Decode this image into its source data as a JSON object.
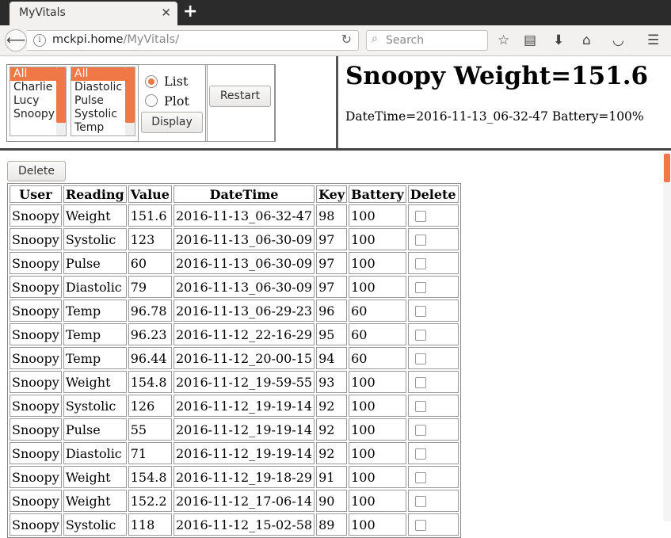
{
  "browser": {
    "tab_title": "MyVitals",
    "url_host": "mckpi.home",
    "url_path": "/MyVitals/",
    "search_placeholder": "Search"
  },
  "controls": {
    "users": [
      {
        "label": "All",
        "selected": true
      },
      {
        "label": "Charlie",
        "selected": false
      },
      {
        "label": "Lucy",
        "selected": false
      },
      {
        "label": "Snoopy",
        "selected": false
      }
    ],
    "readings": [
      {
        "label": "All",
        "selected": true
      },
      {
        "label": "Diastolic",
        "selected": false
      },
      {
        "label": "Pulse",
        "selected": false
      },
      {
        "label": "Systolic",
        "selected": false
      },
      {
        "label": "Temp",
        "selected": false
      }
    ],
    "mode_list_label": "List",
    "mode_plot_label": "Plot",
    "mode_selected": "List",
    "display_label": "Display",
    "restart_label": "Restart"
  },
  "summary": {
    "title": "Snoopy Weight=151.6",
    "info": "DateTime=2016-11-13_06-32-47 Battery=100%"
  },
  "delete_label": "Delete",
  "table": {
    "headers": [
      "User",
      "Reading",
      "Value",
      "DateTime",
      "Key",
      "Battery",
      "Delete"
    ],
    "rows": [
      [
        "Snoopy",
        "Weight",
        "151.6",
        "2016-11-13_06-32-47",
        "98",
        "100"
      ],
      [
        "Snoopy",
        "Systolic",
        "123",
        "2016-11-13_06-30-09",
        "97",
        "100"
      ],
      [
        "Snoopy",
        "Pulse",
        "60",
        "2016-11-13_06-30-09",
        "97",
        "100"
      ],
      [
        "Snoopy",
        "Diastolic",
        "79",
        "2016-11-13_06-30-09",
        "97",
        "100"
      ],
      [
        "Snoopy",
        "Temp",
        "96.78",
        "2016-11-13_06-29-23",
        "96",
        "60"
      ],
      [
        "Snoopy",
        "Temp",
        "96.23",
        "2016-11-12_22-16-29",
        "95",
        "60"
      ],
      [
        "Snoopy",
        "Temp",
        "96.44",
        "2016-11-12_20-00-15",
        "94",
        "60"
      ],
      [
        "Snoopy",
        "Weight",
        "154.8",
        "2016-11-12_19-59-55",
        "93",
        "100"
      ],
      [
        "Snoopy",
        "Systolic",
        "126",
        "2016-11-12_19-19-14",
        "92",
        "100"
      ],
      [
        "Snoopy",
        "Pulse",
        "55",
        "2016-11-12_19-19-14",
        "92",
        "100"
      ],
      [
        "Snoopy",
        "Diastolic",
        "71",
        "2016-11-12_19-19-14",
        "92",
        "100"
      ],
      [
        "Snoopy",
        "Weight",
        "154.8",
        "2016-11-12_19-18-29",
        "91",
        "100"
      ],
      [
        "Snoopy",
        "Weight",
        "152.2",
        "2016-11-12_17-06-14",
        "90",
        "100"
      ],
      [
        "Snoopy",
        "Systolic",
        "118",
        "2016-11-12_15-02-58",
        "89",
        "100"
      ]
    ]
  }
}
